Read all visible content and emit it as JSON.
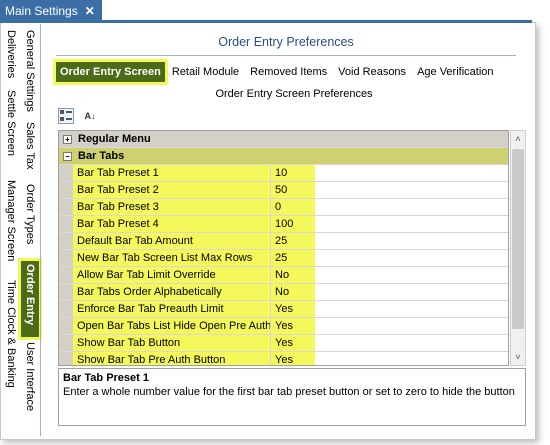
{
  "window": {
    "tab_title": "Main Settings",
    "close_glyph": "✕"
  },
  "side_tabs": {
    "col1": [
      "Deliveries",
      "Settle Screen",
      "Manager Screen",
      "Time Clock & Banking"
    ],
    "col2": [
      "General Settings",
      "Sales Tax",
      "Order Types",
      "Order Entry",
      "User Interface"
    ],
    "active": "Order Entry"
  },
  "header": {
    "title": "Order Entry Preferences"
  },
  "tabs": [
    "Order Entry Screen",
    "Retail Module",
    "Removed Items",
    "Void Reasons",
    "Age Verification"
  ],
  "active_tab": "Order Entry Screen",
  "subtitle": "Order Entry Screen Preferences",
  "toolbar": {
    "categorized_icon": "categorized-icon",
    "alphabetical_icon": "alphabetical-sort-icon",
    "alpha_glyph": "A↓"
  },
  "grid": {
    "categories": [
      {
        "name": "Regular Menu",
        "expanded": false,
        "expander": "+"
      },
      {
        "name": "Bar Tabs",
        "expanded": true,
        "expander": "−"
      }
    ],
    "properties": [
      {
        "name": "Bar Tab Preset 1",
        "value": "10"
      },
      {
        "name": "Bar Tab Preset 2",
        "value": "50"
      },
      {
        "name": "Bar Tab Preset 3",
        "value": "0"
      },
      {
        "name": "Bar Tab Preset 4",
        "value": "100"
      },
      {
        "name": "Default Bar Tab Amount",
        "value": "25"
      },
      {
        "name": "New Bar Tab Screen List Max Rows",
        "value": "25"
      },
      {
        "name": "Allow Bar Tab Limit Override",
        "value": "No"
      },
      {
        "name": "Bar Tabs Order Alphabetically",
        "value": "No"
      },
      {
        "name": "Enforce Bar Tab Preauth Limit",
        "value": "Yes"
      },
      {
        "name": "Open Bar Tabs List Hide Open Pre Auths",
        "value": "Yes"
      },
      {
        "name": "Show Bar Tab Button",
        "value": "Yes"
      },
      {
        "name": "Show Bar Tab Pre Auth Button",
        "value": "Yes"
      }
    ]
  },
  "scroll": {
    "up_glyph": "˄",
    "down_glyph": "˅"
  },
  "description": {
    "title": "Bar Tab Preset 1",
    "text": "Enter a whole number value for the first bar tab preset button or set to zero to hide the button"
  },
  "colors": {
    "accent": "#4b6b16",
    "highlight": "#f4f85a",
    "title_blue": "#2a4e8c",
    "window_tab": "#3a6ea5"
  }
}
